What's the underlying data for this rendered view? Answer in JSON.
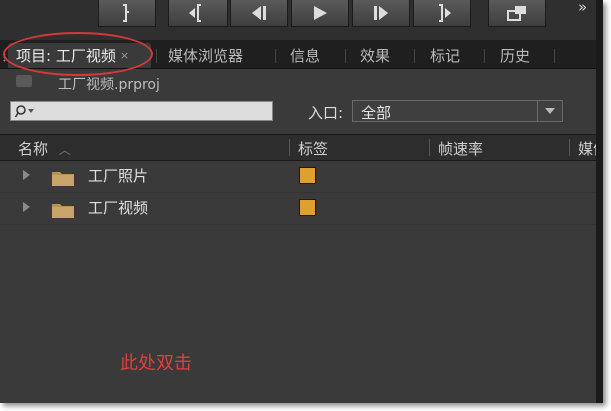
{
  "toolbar": {
    "buttons": [
      {
        "name": "mark-out-icon"
      },
      {
        "name": "go-to-in-icon"
      },
      {
        "name": "step-back-icon"
      },
      {
        "name": "play-icon"
      },
      {
        "name": "step-forward-icon"
      },
      {
        "name": "go-to-out-icon"
      },
      {
        "name": "export-frame-icon"
      }
    ],
    "more": "»"
  },
  "tabs": [
    {
      "label": "项目: 工厂视频",
      "close": "×",
      "active": true
    },
    {
      "label": "媒体浏览器"
    },
    {
      "label": "信息"
    },
    {
      "label": "效果"
    },
    {
      "label": "标记"
    },
    {
      "label": "历史"
    }
  ],
  "panel": {
    "project_file": "工厂视频.prproj",
    "item_count": "2",
    "search": {
      "value": ""
    },
    "entry_label": "入口:",
    "entry_value": "全部",
    "columns": [
      "名称",
      "标签",
      "帧速率",
      "媒体"
    ],
    "rows": [
      {
        "name": "工厂照片",
        "label_color": "#e0a030"
      },
      {
        "name": "工厂视频",
        "label_color": "#e0a030"
      }
    ]
  },
  "annotation": {
    "hint_text": "此处双击",
    "hint_color": "#e0403a",
    "oval_color": "#d23a3a"
  }
}
